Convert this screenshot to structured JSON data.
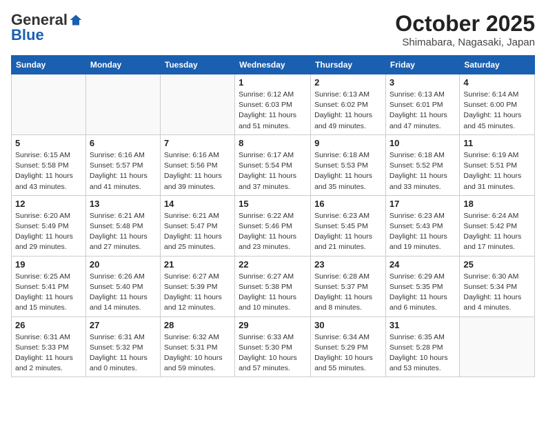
{
  "header": {
    "logo_general": "General",
    "logo_blue": "Blue",
    "month_title": "October 2025",
    "location": "Shimabara, Nagasaki, Japan"
  },
  "days_of_week": [
    "Sunday",
    "Monday",
    "Tuesday",
    "Wednesday",
    "Thursday",
    "Friday",
    "Saturday"
  ],
  "weeks": [
    [
      {
        "day": "",
        "info": ""
      },
      {
        "day": "",
        "info": ""
      },
      {
        "day": "",
        "info": ""
      },
      {
        "day": "1",
        "info": "Sunrise: 6:12 AM\nSunset: 6:03 PM\nDaylight: 11 hours\nand 51 minutes."
      },
      {
        "day": "2",
        "info": "Sunrise: 6:13 AM\nSunset: 6:02 PM\nDaylight: 11 hours\nand 49 minutes."
      },
      {
        "day": "3",
        "info": "Sunrise: 6:13 AM\nSunset: 6:01 PM\nDaylight: 11 hours\nand 47 minutes."
      },
      {
        "day": "4",
        "info": "Sunrise: 6:14 AM\nSunset: 6:00 PM\nDaylight: 11 hours\nand 45 minutes."
      }
    ],
    [
      {
        "day": "5",
        "info": "Sunrise: 6:15 AM\nSunset: 5:58 PM\nDaylight: 11 hours\nand 43 minutes."
      },
      {
        "day": "6",
        "info": "Sunrise: 6:16 AM\nSunset: 5:57 PM\nDaylight: 11 hours\nand 41 minutes."
      },
      {
        "day": "7",
        "info": "Sunrise: 6:16 AM\nSunset: 5:56 PM\nDaylight: 11 hours\nand 39 minutes."
      },
      {
        "day": "8",
        "info": "Sunrise: 6:17 AM\nSunset: 5:54 PM\nDaylight: 11 hours\nand 37 minutes."
      },
      {
        "day": "9",
        "info": "Sunrise: 6:18 AM\nSunset: 5:53 PM\nDaylight: 11 hours\nand 35 minutes."
      },
      {
        "day": "10",
        "info": "Sunrise: 6:18 AM\nSunset: 5:52 PM\nDaylight: 11 hours\nand 33 minutes."
      },
      {
        "day": "11",
        "info": "Sunrise: 6:19 AM\nSunset: 5:51 PM\nDaylight: 11 hours\nand 31 minutes."
      }
    ],
    [
      {
        "day": "12",
        "info": "Sunrise: 6:20 AM\nSunset: 5:49 PM\nDaylight: 11 hours\nand 29 minutes."
      },
      {
        "day": "13",
        "info": "Sunrise: 6:21 AM\nSunset: 5:48 PM\nDaylight: 11 hours\nand 27 minutes."
      },
      {
        "day": "14",
        "info": "Sunrise: 6:21 AM\nSunset: 5:47 PM\nDaylight: 11 hours\nand 25 minutes."
      },
      {
        "day": "15",
        "info": "Sunrise: 6:22 AM\nSunset: 5:46 PM\nDaylight: 11 hours\nand 23 minutes."
      },
      {
        "day": "16",
        "info": "Sunrise: 6:23 AM\nSunset: 5:45 PM\nDaylight: 11 hours\nand 21 minutes."
      },
      {
        "day": "17",
        "info": "Sunrise: 6:23 AM\nSunset: 5:43 PM\nDaylight: 11 hours\nand 19 minutes."
      },
      {
        "day": "18",
        "info": "Sunrise: 6:24 AM\nSunset: 5:42 PM\nDaylight: 11 hours\nand 17 minutes."
      }
    ],
    [
      {
        "day": "19",
        "info": "Sunrise: 6:25 AM\nSunset: 5:41 PM\nDaylight: 11 hours\nand 15 minutes."
      },
      {
        "day": "20",
        "info": "Sunrise: 6:26 AM\nSunset: 5:40 PM\nDaylight: 11 hours\nand 14 minutes."
      },
      {
        "day": "21",
        "info": "Sunrise: 6:27 AM\nSunset: 5:39 PM\nDaylight: 11 hours\nand 12 minutes."
      },
      {
        "day": "22",
        "info": "Sunrise: 6:27 AM\nSunset: 5:38 PM\nDaylight: 11 hours\nand 10 minutes."
      },
      {
        "day": "23",
        "info": "Sunrise: 6:28 AM\nSunset: 5:37 PM\nDaylight: 11 hours\nand 8 minutes."
      },
      {
        "day": "24",
        "info": "Sunrise: 6:29 AM\nSunset: 5:35 PM\nDaylight: 11 hours\nand 6 minutes."
      },
      {
        "day": "25",
        "info": "Sunrise: 6:30 AM\nSunset: 5:34 PM\nDaylight: 11 hours\nand 4 minutes."
      }
    ],
    [
      {
        "day": "26",
        "info": "Sunrise: 6:31 AM\nSunset: 5:33 PM\nDaylight: 11 hours\nand 2 minutes."
      },
      {
        "day": "27",
        "info": "Sunrise: 6:31 AM\nSunset: 5:32 PM\nDaylight: 11 hours\nand 0 minutes."
      },
      {
        "day": "28",
        "info": "Sunrise: 6:32 AM\nSunset: 5:31 PM\nDaylight: 10 hours\nand 59 minutes."
      },
      {
        "day": "29",
        "info": "Sunrise: 6:33 AM\nSunset: 5:30 PM\nDaylight: 10 hours\nand 57 minutes."
      },
      {
        "day": "30",
        "info": "Sunrise: 6:34 AM\nSunset: 5:29 PM\nDaylight: 10 hours\nand 55 minutes."
      },
      {
        "day": "31",
        "info": "Sunrise: 6:35 AM\nSunset: 5:28 PM\nDaylight: 10 hours\nand 53 minutes."
      },
      {
        "day": "",
        "info": ""
      }
    ]
  ]
}
